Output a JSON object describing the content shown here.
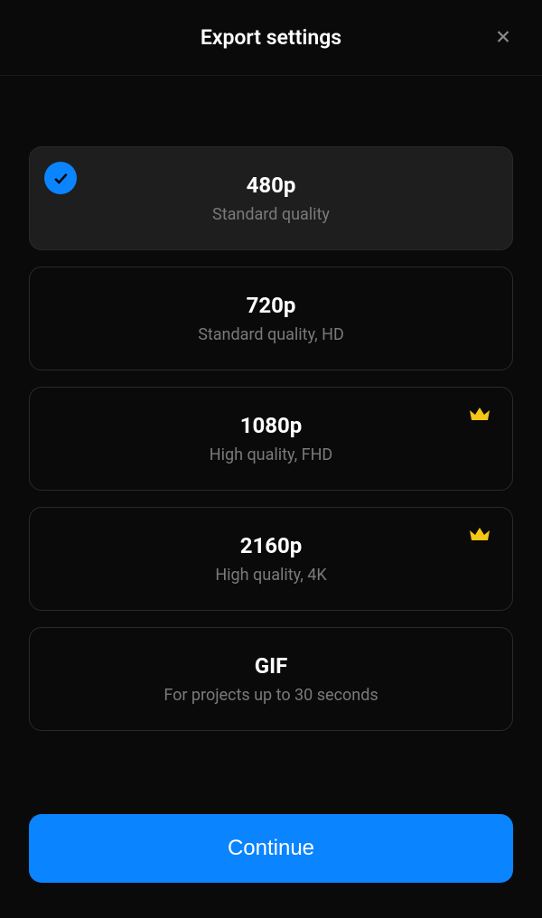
{
  "header": {
    "title": "Export settings"
  },
  "options": [
    {
      "title": "480p",
      "subtitle": "Standard quality",
      "selected": true,
      "premium": false
    },
    {
      "title": "720p",
      "subtitle": "Standard quality, HD",
      "selected": false,
      "premium": false
    },
    {
      "title": "1080p",
      "subtitle": "High quality, FHD",
      "selected": false,
      "premium": true
    },
    {
      "title": "2160p",
      "subtitle": "High quality, 4K",
      "selected": false,
      "premium": true
    },
    {
      "title": "GIF",
      "subtitle": "For projects up to 30 seconds",
      "selected": false,
      "premium": false
    }
  ],
  "footer": {
    "continue_label": "Continue"
  }
}
